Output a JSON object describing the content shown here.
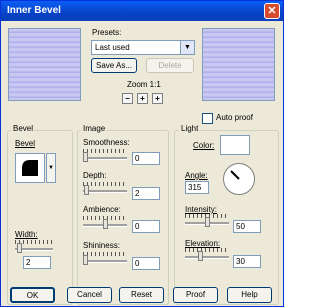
{
  "window": {
    "title": "Inner Bevel",
    "close_glyph": "✕"
  },
  "presets": {
    "label": "Presets:",
    "value": "Last used",
    "save_as": "Save As...",
    "delete": "Delete"
  },
  "zoom": {
    "label": "Zoom 1:1",
    "zoom_out": "−",
    "pan": "+",
    "zoom_in": "+"
  },
  "auto_proof": {
    "label": "Auto proof",
    "checked": false
  },
  "bevel": {
    "group_title": "Bevel",
    "bevel_label": "Bevel",
    "width_label": "Width:",
    "width_value": "2",
    "width_level": 0.05
  },
  "image": {
    "group_title": "Image",
    "smoothness_label": "Smoothness:",
    "smoothness_value": "0",
    "smoothness_level": 0.0,
    "depth_label": "Depth:",
    "depth_value": "2",
    "depth_level": 0.02,
    "ambience_label": "Ambience:",
    "ambience_value": "0",
    "ambience_level": 0.5,
    "shininess_label": "Shininess:",
    "shininess_value": "0",
    "shininess_level": 0.0
  },
  "light": {
    "group_title": "Light",
    "color_label": "Color:",
    "color_value": "#ffffff",
    "angle_label": "Angle:",
    "angle_value": "315",
    "intensity_label": "Intensity:",
    "intensity_value": "50",
    "intensity_level": 0.5,
    "elevation_label": "Elevation:",
    "elevation_value": "30",
    "elevation_level": 0.33
  },
  "footer": {
    "ok": "OK",
    "cancel": "Cancel",
    "reset": "Reset",
    "proof": "Proof",
    "help": "Help"
  }
}
